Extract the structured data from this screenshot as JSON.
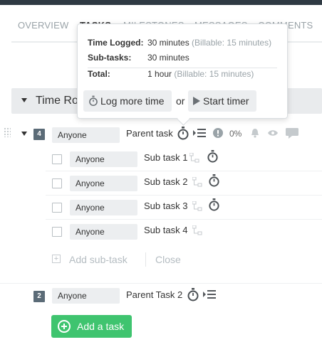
{
  "tabs": {
    "overview": "OVERVIEW",
    "tasks": "TASKS",
    "milestones": "MILESTONES",
    "messages": "MESSAGES",
    "comments": "COMMENTS"
  },
  "section": {
    "title": "Time Ro"
  },
  "parent_task_1": {
    "number": "4",
    "assignee": "Anyone",
    "name": "Parent task",
    "progress": "0%",
    "subtasks": [
      {
        "assignee": "Anyone",
        "name": "Sub task 1",
        "has_timer": true
      },
      {
        "assignee": "Anyone",
        "name": "Sub task 2",
        "has_timer": true
      },
      {
        "assignee": "Anyone",
        "name": "Sub task 3",
        "has_timer": true
      },
      {
        "assignee": "Anyone",
        "name": "Sub task 4",
        "has_timer": false
      }
    ]
  },
  "add_subtask": {
    "label": "Add sub-task",
    "close": "Close"
  },
  "parent_task_2": {
    "number": "2",
    "assignee": "Anyone",
    "name": "Parent Task 2"
  },
  "add_task_button": "Add a task",
  "popover": {
    "time_logged_label": "Time Logged:",
    "time_logged_value": "30 minutes",
    "time_logged_billable": "(Billable: 15 minutes)",
    "subtasks_label": "Sub-tasks:",
    "subtasks_value": "30 minutes",
    "total_label": "Total:",
    "total_value": "1 hour",
    "total_billable": "(Billable: 15 minutes)",
    "log_more_time": "Log more time",
    "or": "or",
    "start_timer": "Start timer"
  },
  "colors": {
    "accent_green": "#3fc46f",
    "badge": "#5b6b77",
    "topbar": "#2f3a43"
  }
}
